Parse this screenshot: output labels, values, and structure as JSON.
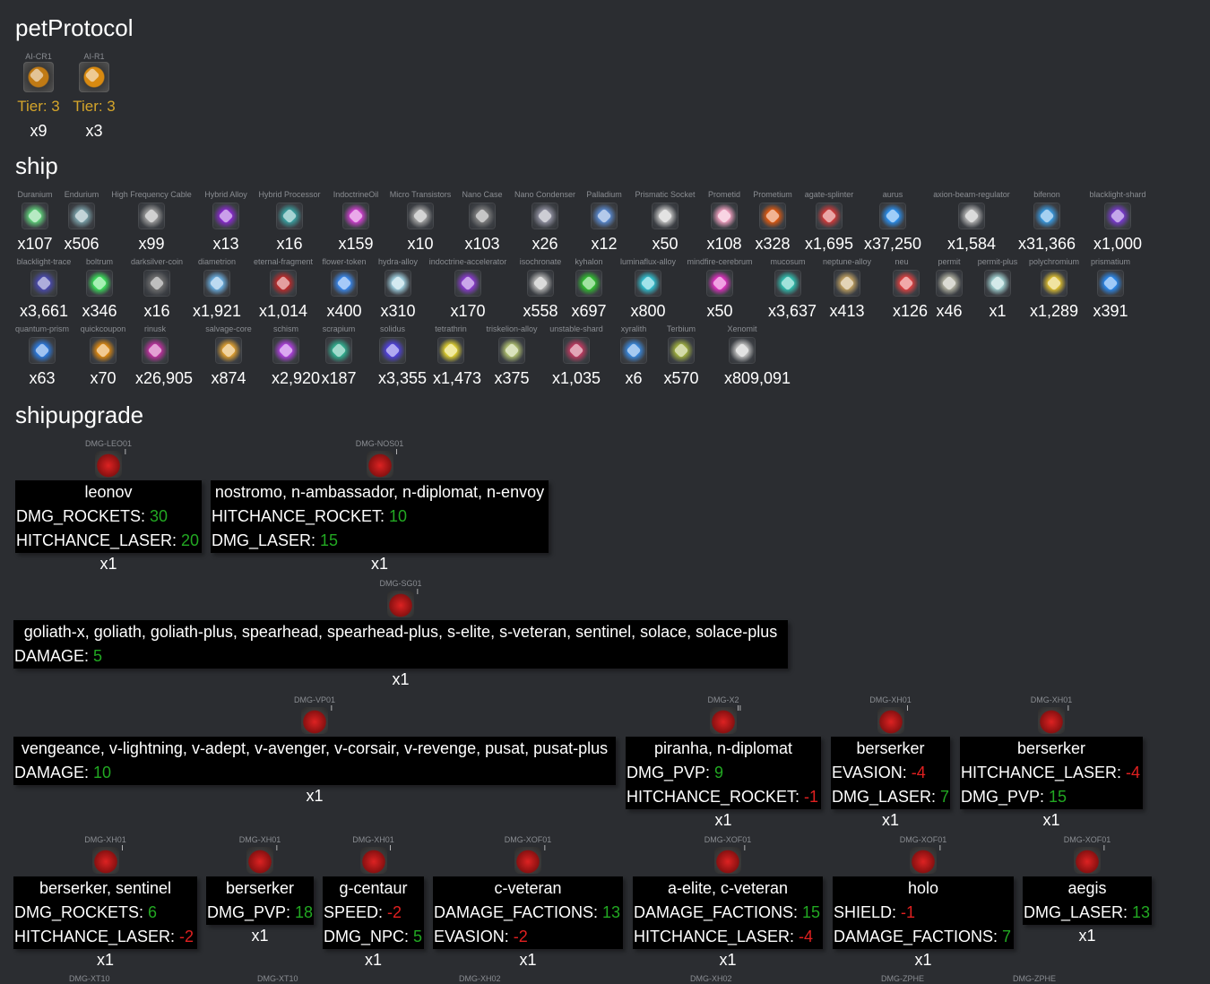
{
  "sections": {
    "petProtocol": "petProtocol",
    "ship": "ship",
    "shipupgrade": "shipupgrade"
  },
  "pet_protocol": [
    {
      "label": "AI-CR1",
      "tier": "Tier: 3",
      "count": "x9",
      "color": "#c07a14"
    },
    {
      "label": "AI-R1",
      "tier": "Tier: 3",
      "count": "x3",
      "color": "#d98a10"
    }
  ],
  "ship_rows": [
    [
      {
        "label": "Duranium",
        "count": "x107",
        "color": "#5fd07a"
      },
      {
        "label": "Endurium",
        "count": "x506",
        "color": "#7aa0a8"
      },
      {
        "label": "High Frequency Cable",
        "count": "x99",
        "color": "#9a9a9a"
      },
      {
        "label": "Hybrid Alloy",
        "count": "x13",
        "color": "#8a2ad0"
      },
      {
        "label": "Hybrid Processor",
        "count": "x16",
        "color": "#3aa0a0"
      },
      {
        "label": "IndoctrineOil",
        "count": "x159",
        "color": "#d040d0"
      },
      {
        "label": "Micro Transistors",
        "count": "x10",
        "color": "#a0a0a0"
      },
      {
        "label": "Nano Case",
        "count": "x103",
        "color": "#808080"
      },
      {
        "label": "Nano Condenser",
        "count": "x26",
        "color": "#9090a0"
      },
      {
        "label": "Palladium",
        "count": "x12",
        "color": "#5a8ad0"
      },
      {
        "label": "Prismatic Socket",
        "count": "x50",
        "color": "#c0c0c0"
      },
      {
        "label": "Prometid",
        "count": "x108",
        "color": "#f0a0c0"
      },
      {
        "label": "Prometium",
        "count": "x328",
        "color": "#e05a10"
      },
      {
        "label": "agate-splinter",
        "count": "x1,695",
        "color": "#d03a3a"
      },
      {
        "label": "aurus",
        "count": "x37,250",
        "color": "#2a90f0"
      },
      {
        "label": "axion-beam-regulator",
        "count": "x1,584",
        "color": "#b0b0b0"
      },
      {
        "label": "bifenon",
        "count": "x31,366",
        "color": "#3a9ae0"
      },
      {
        "label": "blacklight-shard",
        "count": "x1,000",
        "color": "#7a3ad0"
      }
    ],
    [
      {
        "label": "blacklight-trace",
        "count": "x3,661",
        "color": "#4a4ab0"
      },
      {
        "label": "boltrum",
        "count": "x346",
        "color": "#3ae05a"
      },
      {
        "label": "darksilver-coin",
        "count": "x16",
        "color": "#707070"
      },
      {
        "label": "diametrion",
        "count": "x1,921",
        "color": "#6aaee0"
      },
      {
        "label": "eternal-fragment",
        "count": "x1,014",
        "color": "#c02a2a"
      },
      {
        "label": "flower-token",
        "count": "x400",
        "color": "#3a8af0"
      },
      {
        "label": "hydra-alloy",
        "count": "x310",
        "color": "#a0d0e0"
      },
      {
        "label": "indoctrine-accelerator",
        "count": "x170",
        "color": "#8a3ad0"
      },
      {
        "label": "isochronate",
        "count": "x558",
        "color": "#b0b0b0"
      },
      {
        "label": "kyhalon",
        "count": "x697",
        "color": "#30c030"
      },
      {
        "label": "luminaflux-alloy",
        "count": "x800",
        "color": "#30c0d0"
      },
      {
        "label": "mindfire-cerebrum",
        "count": "x50",
        "color": "#e030c0"
      },
      {
        "label": "mucosum",
        "count": "x3,637",
        "color": "#30c0b0"
      },
      {
        "label": "neptune-alloy",
        "count": "x413",
        "color": "#c0a060"
      },
      {
        "label": "neu",
        "count": "x126",
        "color": "#e04040"
      },
      {
        "label": "permit",
        "count": "x46",
        "color": "#b0b0a0"
      },
      {
        "label": "permit-plus",
        "count": "x1",
        "color": "#a0d0d0"
      },
      {
        "label": "polychromium",
        "count": "x1,289",
        "color": "#e0c030"
      },
      {
        "label": "prismatium",
        "count": "x391",
        "color": "#2a8af0"
      }
    ],
    [
      {
        "label": "quantum-prism",
        "count": "x63",
        "color": "#2a7ae0"
      },
      {
        "label": "quickcoupon",
        "count": "x70",
        "color": "#e08a10"
      },
      {
        "label": "rinusk",
        "count": "x26,905",
        "color": "#c030a0"
      },
      {
        "label": "salvage-core",
        "count": "x874",
        "color": "#e0a030"
      },
      {
        "label": "schism",
        "count": "x2,920",
        "color": "#b040e0"
      },
      {
        "label": "scrapium",
        "count": "x187",
        "color": "#30b090"
      },
      {
        "label": "solidus",
        "count": "x3,355",
        "color": "#5040e0"
      },
      {
        "label": "tetrathrin",
        "count": "x1,473",
        "color": "#e0d030"
      },
      {
        "label": "triskelion-alloy",
        "count": "x375",
        "color": "#b0c070"
      },
      {
        "label": "unstable-shard",
        "count": "x1,035",
        "color": "#c03a60"
      },
      {
        "label": "xyralith",
        "count": "x6",
        "color": "#3a8ae0"
      },
      {
        "label": "Terbium",
        "count": "x570",
        "color": "#a0b040"
      },
      {
        "label": "Xenomit",
        "count": "x809,091",
        "color": "#c0c0c0"
      }
    ]
  ],
  "upgrades": [
    {
      "id": "DMG-LEO01",
      "roman": "I",
      "name": "leonov",
      "stats": [
        {
          "k": "DMG_ROCKETS: ",
          "v": "30",
          "sign": "pos"
        },
        {
          "k": "HITCHANCE_LASER: ",
          "v": "20",
          "sign": "pos"
        }
      ],
      "count": "x1"
    },
    {
      "id": "DMG-NOS01",
      "roman": "I",
      "name": "nostromo, n-ambassador, n-diplomat, n-envoy",
      "stats": [
        {
          "k": "HITCHANCE_ROCKET: ",
          "v": "10",
          "sign": "pos"
        },
        {
          "k": "DMG_LASER: ",
          "v": "15",
          "sign": "pos"
        }
      ],
      "count": "x1"
    },
    {
      "id": "DMG-SG01",
      "roman": "I",
      "name": "goliath-x, goliath, goliath-plus, spearhead, spearhead-plus, s-elite, s-veteran, sentinel, solace, solace-plus",
      "stats": [
        {
          "k": "DAMAGE: ",
          "v": "5",
          "sign": "pos"
        }
      ],
      "count": "x1"
    },
    {
      "id": "DMG-VP01",
      "roman": "I",
      "name": "vengeance, v-lightning, v-adept, v-avenger, v-corsair, v-revenge, pusat, pusat-plus",
      "stats": [
        {
          "k": "DAMAGE: ",
          "v": "10",
          "sign": "pos"
        }
      ],
      "count": "x1"
    },
    {
      "id": "DMG-X2",
      "roman": "II",
      "name": "piranha, n-diplomat",
      "stats": [
        {
          "k": "DMG_PVP: ",
          "v": "9",
          "sign": "pos"
        },
        {
          "k": "HITCHANCE_ROCKET: ",
          "v": "-1",
          "sign": "neg"
        }
      ],
      "count": "x1"
    },
    {
      "id": "DMG-XH01",
      "roman": "I",
      "name": "berserker",
      "stats": [
        {
          "k": "EVASION: ",
          "v": "-4",
          "sign": "neg"
        },
        {
          "k": "DMG_LASER: ",
          "v": "7",
          "sign": "pos"
        }
      ],
      "count": "x1"
    },
    {
      "id": "DMG-XH01",
      "roman": "I",
      "name": "berserker",
      "stats": [
        {
          "k": "HITCHANCE_LASER: ",
          "v": "-4",
          "sign": "neg"
        },
        {
          "k": "DMG_PVP: ",
          "v": "15",
          "sign": "pos"
        }
      ],
      "count": "x1"
    },
    {
      "id": "DMG-XH01",
      "roman": "I",
      "name": "berserker, sentinel",
      "stats": [
        {
          "k": "DMG_ROCKETS: ",
          "v": "6",
          "sign": "pos"
        },
        {
          "k": "HITCHANCE_LASER: ",
          "v": "-2",
          "sign": "neg"
        }
      ],
      "count": "x1"
    },
    {
      "id": "DMG-XH01",
      "roman": "I",
      "name": "berserker",
      "stats": [
        {
          "k": "DMG_PVP: ",
          "v": "18",
          "sign": "pos"
        }
      ],
      "count": "x1"
    },
    {
      "id": "DMG-XH01",
      "roman": "I",
      "name": "g-centaur",
      "stats": [
        {
          "k": "SPEED: ",
          "v": "-2",
          "sign": "neg"
        },
        {
          "k": "DMG_NPC: ",
          "v": "5",
          "sign": "pos"
        }
      ],
      "count": "x1"
    },
    {
      "id": "DMG-XOF01",
      "roman": "I",
      "name": "c-veteran",
      "stats": [
        {
          "k": "DAMAGE_FACTIONS: ",
          "v": "13",
          "sign": "pos"
        },
        {
          "k": "EVASION: ",
          "v": "-2",
          "sign": "neg"
        }
      ],
      "count": "x1"
    },
    {
      "id": "DMG-XOF01",
      "roman": "I",
      "name": "a-elite, c-veteran",
      "stats": [
        {
          "k": "DAMAGE_FACTIONS: ",
          "v": "15",
          "sign": "pos"
        },
        {
          "k": "HITCHANCE_LASER: ",
          "v": "-4",
          "sign": "neg"
        }
      ],
      "count": "x1"
    },
    {
      "id": "DMG-XOF01",
      "roman": "I",
      "name": "holo",
      "stats": [
        {
          "k": "SHIELD: ",
          "v": "-1",
          "sign": "neg"
        },
        {
          "k": "DAMAGE_FACTIONS: ",
          "v": "7",
          "sign": "pos"
        }
      ],
      "count": "x1"
    },
    {
      "id": "DMG-XOF01",
      "roman": "I",
      "name": "aegis",
      "stats": [
        {
          "k": "DMG_LASER: ",
          "v": "13",
          "sign": "pos"
        }
      ],
      "count": "x1"
    }
  ],
  "partial_row": [
    "DMG-XT10",
    "DMG-XT10",
    "DMG-XH02",
    "DMG-XH02",
    "DMG-ZPHE",
    "DMG-ZPHE"
  ]
}
